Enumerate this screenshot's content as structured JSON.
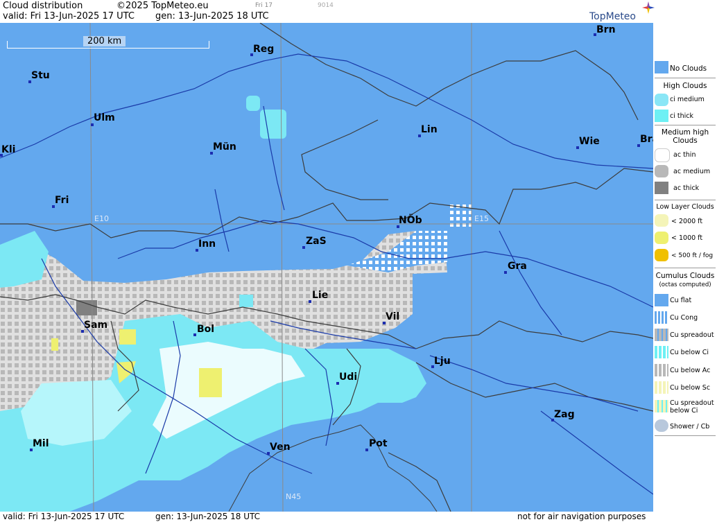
{
  "header": {
    "title": "Cloud distribution",
    "copyright": "©2025 TopMeteo.eu",
    "small1": "Fri 17",
    "small2": "9014",
    "valid": "valid:  Fri  13-Jun-2025  17 UTC",
    "gen": "gen: 13-Jun-2025 18 UTC"
  },
  "logo": "TopMeteo",
  "scale": "200 km",
  "grid_labels": {
    "e10": "E10",
    "e15": "E15",
    "n45": "N45"
  },
  "cities": [
    {
      "name": "Brn"
    },
    {
      "name": "Reg"
    },
    {
      "name": "Stu"
    },
    {
      "name": "Ulm"
    },
    {
      "name": "Lin"
    },
    {
      "name": "Kli"
    },
    {
      "name": "Mün"
    },
    {
      "name": "Wie"
    },
    {
      "name": "Bra"
    },
    {
      "name": "Fri"
    },
    {
      "name": "NÖb"
    },
    {
      "name": "Inn"
    },
    {
      "name": "ZaS"
    },
    {
      "name": "Gra"
    },
    {
      "name": "Lie"
    },
    {
      "name": "Vil"
    },
    {
      "name": "Sam"
    },
    {
      "name": "Bol"
    },
    {
      "name": "Lju"
    },
    {
      "name": "Udi"
    },
    {
      "name": "Zag"
    },
    {
      "name": "Mil"
    },
    {
      "name": "Pot"
    },
    {
      "name": "Ven"
    }
  ],
  "footer": {
    "valid": "valid:  Fri  13-Jun-2025  17 UTC",
    "gen": "gen: 13-Jun-2025 18 UTC",
    "note": "not for air navigation purposes"
  },
  "legend": {
    "no_clouds": "No Clouds",
    "high_head": "High Clouds",
    "ci_medium": "ci medium",
    "ci_thick": "ci thick",
    "mid_head": "Medium high Clouds",
    "ac_thin": "ac thin",
    "ac_medium": "ac medium",
    "ac_thick": "ac thick",
    "low_head": "Low Layer Clouds",
    "low1": "< 2000 ft",
    "low2": "< 1000 ft",
    "low3": "< 500 ft / fog",
    "cu_head": "Cumulus Clouds",
    "cu_sub": "(octas computed)",
    "cu_flat": "Cu flat",
    "cu_cong": "Cu Cong",
    "cu_spread": "Cu spreadout",
    "cu_below_ci": "Cu below Ci",
    "cu_below_ac": "Cu below Ac",
    "cu_below_sc": "Cu below Sc",
    "cu_spread_ci_1": "Cu spreadout",
    "cu_spread_ci_2": "below Ci",
    "shower": "Shower / Cb"
  },
  "colors": {
    "no_clouds": "#63a8ee",
    "ci_medium": "#8ae6f6",
    "ci_thick": "#6ef0f4",
    "ac_thin": "#ffffff",
    "ac_medium": "#b8b8b8",
    "ac_thick": "#808080",
    "low_2000": "#f4f4b8",
    "low_1000": "#eef070",
    "low_500": "#f0c000",
    "borders": "#3c3c3c",
    "rivers": "#1a3aa8"
  }
}
